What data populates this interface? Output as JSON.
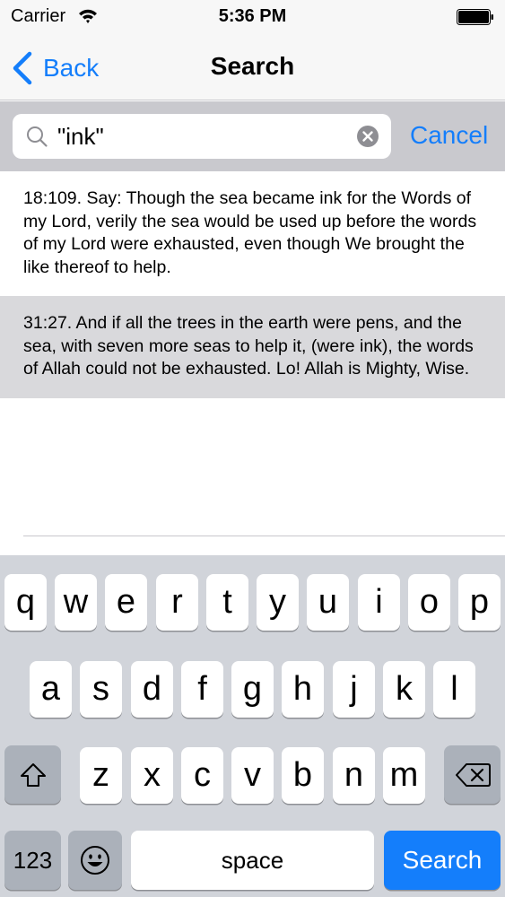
{
  "status_bar": {
    "carrier": "Carrier",
    "time": "5:36 PM"
  },
  "nav": {
    "back_label": "Back",
    "title": "Search"
  },
  "search": {
    "query": "\"ink\"",
    "cancel_label": "Cancel"
  },
  "results": [
    {
      "text": "18:109. Say: Though the sea became ink for the Words of my Lord, verily the sea would be used up before the words of my Lord were exhausted, even though We brought the like thereof to help.",
      "selected": false
    },
    {
      "text": "31:27. And if all the trees in the earth were pens, and the sea, with seven more seas to help it, (were ink), the words of Allah could not be exhausted. Lo! Allah is Mighty, Wise.",
      "selected": true
    }
  ],
  "keyboard": {
    "row1": [
      "q",
      "w",
      "e",
      "r",
      "t",
      "y",
      "u",
      "i",
      "o",
      "p"
    ],
    "row2": [
      "a",
      "s",
      "d",
      "f",
      "g",
      "h",
      "j",
      "k",
      "l"
    ],
    "row3": [
      "z",
      "x",
      "c",
      "v",
      "b",
      "n",
      "m"
    ],
    "numbers_label": "123",
    "space_label": "space",
    "return_label": "Search",
    "icons": {
      "shift": "shift-icon",
      "delete": "delete-icon",
      "emoji": "emoji-icon"
    }
  },
  "colors": {
    "accent": "#147efb",
    "selected_row": "#d9d9dc",
    "keyboard_bg": "#d1d4da",
    "special_key": "#abb1ba"
  }
}
